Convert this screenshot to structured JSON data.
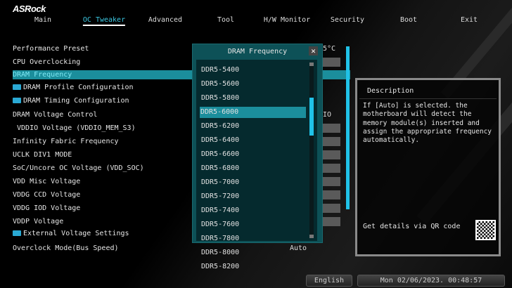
{
  "brand": "ASRock",
  "nav": {
    "tabs": [
      "Main",
      "OC Tweaker",
      "Advanced",
      "Tool",
      "H/W Monitor",
      "Security",
      "Boot",
      "Exit"
    ],
    "active": "OC Tweaker"
  },
  "settings": [
    {
      "label": "Performance Preset",
      "value": "5°C"
    },
    {
      "label": "CPU Overclocking"
    },
    {
      "label": "DRAM Frequency"
    },
    {
      "label": "DRAM Profile Configuration",
      "icon": "profile-icon"
    },
    {
      "label": "DRAM Timing Configuration",
      "icon": "folder-icon"
    },
    {
      "label": "DRAM Voltage Control",
      "value": "IO"
    },
    {
      "label": " VDDIO Voltage (VDDIO_MEM_S3)"
    },
    {
      "label": "Infinity Fabric Frequency"
    },
    {
      "label": "UCLK DIV1 MODE"
    },
    {
      "label": "SoC/Uncore OC Voltage (VDD_SOC)"
    },
    {
      "label": "VDD Misc Voltage"
    },
    {
      "label": "VDDG CCD Voltage"
    },
    {
      "label": "VDDG IOD Voltage"
    },
    {
      "label": "VDDP Voltage"
    },
    {
      "label": "External Voltage Settings",
      "icon": "folder-icon"
    },
    {
      "label": "Overclock Mode(Bus Speed)",
      "value": "Auto"
    }
  ],
  "popup": {
    "title": "DRAM Frequency",
    "close": "✕",
    "options": [
      "DDR5-5400",
      "DDR5-5600",
      "DDR5-5800",
      "DDR5-6000",
      "DDR5-6200",
      "DDR5-6400",
      "DDR5-6600",
      "DDR5-6800",
      "DDR5-7000",
      "DDR5-7200",
      "DDR5-7400",
      "DDR5-7600",
      "DDR5-7800",
      "DDR5-8000",
      "DDR5-8200"
    ],
    "selected": "DDR5-6000"
  },
  "description": {
    "heading": "Description",
    "text": "If [Auto] is selected. the motherboard will detect the memory module(s) inserted and assign the appropriate frequency automatically.",
    "qr_label": "Get details via QR code"
  },
  "footer": {
    "language": "English",
    "datetime": "Mon 02/06/2023. 00:48:57"
  },
  "colors": {
    "accent": "#20c2e8",
    "highlight": "#1b8e9c",
    "popup": "#0d5157"
  }
}
